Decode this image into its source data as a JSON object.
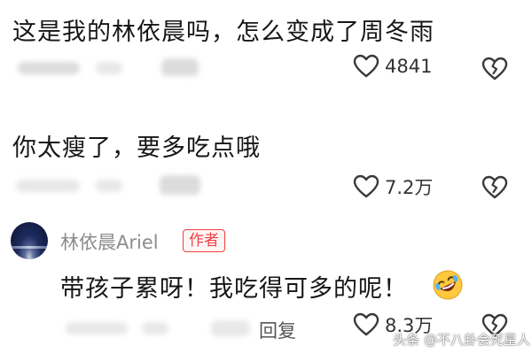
{
  "comments": [
    {
      "text": "这是我的林依晨吗，怎么变成了周冬雨",
      "like_count": "4841"
    },
    {
      "text": "你太瘦了，要多吃点哦",
      "like_count": "7.2万"
    }
  ],
  "reply": {
    "author": "林依晨Ariel",
    "badge": "作者",
    "text": "带孩子累呀！我吃得可多的呢！",
    "emoji": "rolling-on-floor-laughing-emoji",
    "reply_label": "回复",
    "like_count": "8.3万"
  },
  "watermark": "头条 @不八卦会死星人",
  "colors": {
    "badge": "#f04142",
    "text": "#161616",
    "muted": "#8c8c8c"
  }
}
